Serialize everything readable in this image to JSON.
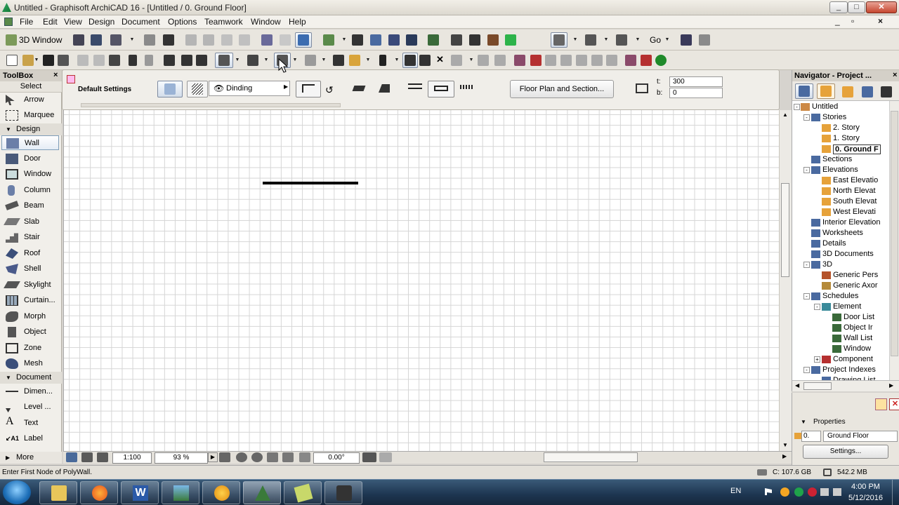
{
  "window": {
    "title": "Untitled - Graphisoft ArchiCAD 16 - [Untitled / 0. Ground Floor]",
    "min": "_",
    "max": "□",
    "close": "✕"
  },
  "menu": [
    "File",
    "Edit",
    "View",
    "Design",
    "Document",
    "Options",
    "Teamwork",
    "Window",
    "Help"
  ],
  "toolbar1": {
    "view_button": "3D Window",
    "go_label": "Go"
  },
  "infobox": {
    "default_settings": "Default Settings",
    "layer": "Dinding",
    "floor_plan": "Floor Plan and Section...",
    "t_label": "t:",
    "t_value": "300",
    "b_label": "b:",
    "b_value": "0"
  },
  "toolbox": {
    "title": "ToolBox",
    "select": "Select",
    "groups": {
      "design": "Design",
      "document": "Document",
      "more": "More"
    },
    "tools": [
      {
        "label": "Arrow",
        "icon": "arrow-icon"
      },
      {
        "label": "Marquee",
        "icon": "marquee-icon"
      },
      {
        "label": "Wall",
        "icon": "wall-icon"
      },
      {
        "label": "Door",
        "icon": "door-icon"
      },
      {
        "label": "Window",
        "icon": "window-icon"
      },
      {
        "label": "Column",
        "icon": "column-icon"
      },
      {
        "label": "Beam",
        "icon": "beam-icon"
      },
      {
        "label": "Slab",
        "icon": "slab-icon"
      },
      {
        "label": "Stair",
        "icon": "stair-icon"
      },
      {
        "label": "Roof",
        "icon": "roof-icon"
      },
      {
        "label": "Shell",
        "icon": "shell-icon"
      },
      {
        "label": "Skylight",
        "icon": "skylight-icon"
      },
      {
        "label": "Curtain...",
        "icon": "curtain-wall-icon"
      },
      {
        "label": "Morph",
        "icon": "morph-icon"
      },
      {
        "label": "Object",
        "icon": "object-icon"
      },
      {
        "label": "Zone",
        "icon": "zone-icon"
      },
      {
        "label": "Mesh",
        "icon": "mesh-icon"
      },
      {
        "label": "Dimen...",
        "icon": "dimension-icon"
      },
      {
        "label": "Level ...",
        "icon": "level-dimension-icon"
      },
      {
        "label": "Text",
        "icon": "text-icon"
      },
      {
        "label": "Label",
        "icon": "label-icon"
      }
    ]
  },
  "bottombar": {
    "scale": "1:100",
    "zoom": "93 %",
    "angle": "0.00°"
  },
  "navigator": {
    "title": "Navigator - Project ...",
    "tree": [
      {
        "label": "Untitled"
      },
      {
        "label": "Stories"
      },
      {
        "label": "2. Story"
      },
      {
        "label": "1. Story"
      },
      {
        "label": "0. Ground F"
      },
      {
        "label": "Sections"
      },
      {
        "label": "Elevations"
      },
      {
        "label": "East Elevatio"
      },
      {
        "label": "North Elevat"
      },
      {
        "label": "South Elevat"
      },
      {
        "label": "West Elevati"
      },
      {
        "label": "Interior Elevation"
      },
      {
        "label": "Worksheets"
      },
      {
        "label": "Details"
      },
      {
        "label": "3D Documents"
      },
      {
        "label": "3D"
      },
      {
        "label": "Generic Pers"
      },
      {
        "label": "Generic Axor"
      },
      {
        "label": "Schedules"
      },
      {
        "label": "Element"
      },
      {
        "label": "Door List"
      },
      {
        "label": "Object Ir"
      },
      {
        "label": "Wall List"
      },
      {
        "label": "Window"
      },
      {
        "label": "Component"
      },
      {
        "label": "Project Indexes"
      },
      {
        "label": "Drawing List"
      }
    ]
  },
  "properties": {
    "title": "Properties",
    "story_num": "0.",
    "story_name": "Ground Floor",
    "settings": "Settings..."
  },
  "status": {
    "message": "Enter First Node of PolyWall.",
    "disk": "C: 107.6 GB",
    "memory": "542.2 MB"
  },
  "taskbar": {
    "lang": "EN",
    "time": "4:00 PM",
    "date": "5/12/2016"
  }
}
